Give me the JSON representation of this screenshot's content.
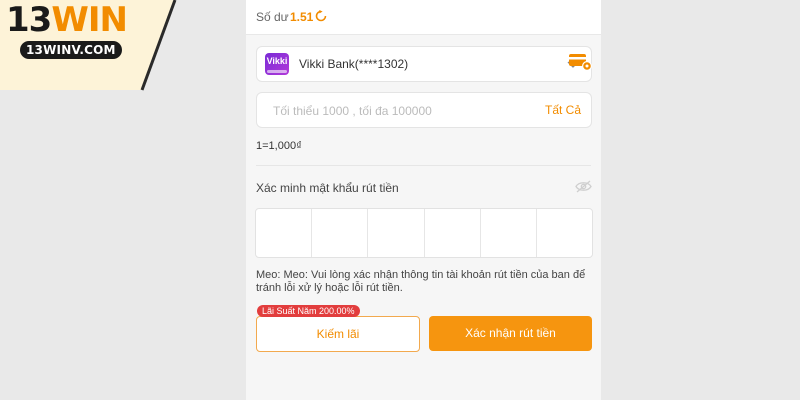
{
  "brand": {
    "logo_number": "13",
    "logo_word": "WIN",
    "domain": "13WINV.COM"
  },
  "balance": {
    "label": "Số dư",
    "value": "1.51",
    "icon": "refresh-icon"
  },
  "bank": {
    "logo_text": "Vikki",
    "name": "Vikki Bank(****1302)",
    "dropdown_icon": "chevron-down-icon",
    "settings_icon": "card-settings-icon"
  },
  "amount": {
    "placeholder": "Tối thiểu 1000 , tối đa 100000",
    "value": "",
    "all_label": "Tất Cả"
  },
  "rate_text": "1=1,000₫",
  "password": {
    "label": "Xác minh mật khẩu rút tiền",
    "visibility_icon": "eye-off-icon",
    "cells": [
      "",
      "",
      "",
      "",
      "",
      ""
    ]
  },
  "tip": "Meo:  Meo: Vui lòng xác nhận thông tin tài khoản rút tiền của ban để tránh lỗi xử lý hoặc lỗi rút tiền.",
  "actions": {
    "badge": "Lãi Suất Năm 200.00%",
    "earn_label": "Kiếm lãi",
    "confirm_label": "Xác nhận rút tiền"
  },
  "colors": {
    "accent": "#f28c00",
    "button": "#f6950f",
    "badge": "#e23d3d",
    "brand_panel": "#fdf3d8"
  }
}
